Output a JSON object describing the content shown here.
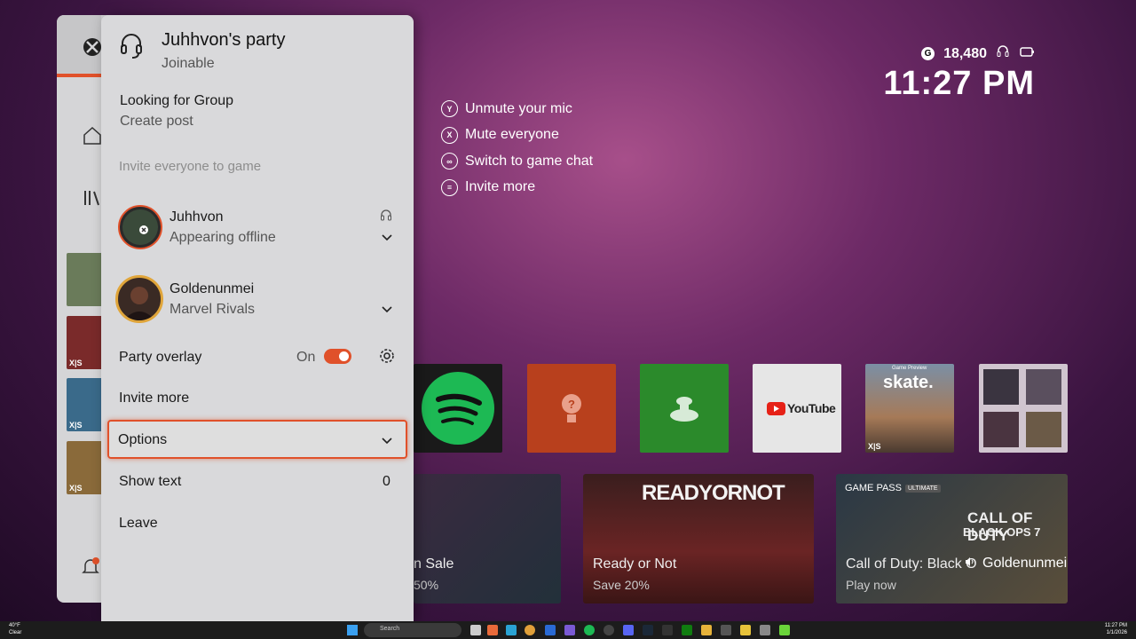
{
  "panel": {
    "title": "Juhhvon's party",
    "status": "Joinable",
    "lfg_title": "Looking for Group",
    "lfg_sub": "Create post",
    "invite_everyone": "Invite everyone to game",
    "members": [
      {
        "name": "Juhhvon",
        "status": "Appearing offline"
      },
      {
        "name": "Goldenunmei",
        "status": "Marvel Rivals"
      }
    ],
    "overlay_label": "Party overlay",
    "overlay_state": "On",
    "invite_more": "Invite more",
    "options": "Options",
    "show_text": "Show text",
    "show_text_count": "0",
    "leave": "Leave"
  },
  "hints": [
    {
      "key": "Y",
      "label": "Unmute your mic"
    },
    {
      "key": "X",
      "label": "Mute everyone"
    },
    {
      "key": "∞",
      "label": "Switch to game chat"
    },
    {
      "key": "≡",
      "label": "Invite more"
    }
  ],
  "hud": {
    "coin": "G",
    "gamerscore": "18,480",
    "time": "11:27 PM"
  },
  "tiles": {
    "youtube": "YouTube",
    "skate_banner": "Game Preview",
    "skate": "skate.",
    "xs": "X|S"
  },
  "cards": [
    {
      "title": "n Sale",
      "sub": "50%"
    },
    {
      "title": "Ready or Not",
      "sub": "Save 20%",
      "art": "READYORNOT"
    },
    {
      "title": "Call of Duty: Black O",
      "sub": "Play now",
      "art1": "CALL OF DUTY",
      "art2": "BLACK OPS 7",
      "badge": "GAME PASS",
      "badge2": "ULTIMATE"
    }
  ],
  "speaking": "Goldenunmei",
  "taskbar": {
    "weather": "40°F",
    "weather_sub": "Clear",
    "search": "Search",
    "time": "11:27 PM",
    "date": "1/1/2026"
  },
  "colors": {
    "accent": "#e0512a",
    "spotify": "#1db954",
    "panel": "#d9d9db"
  }
}
